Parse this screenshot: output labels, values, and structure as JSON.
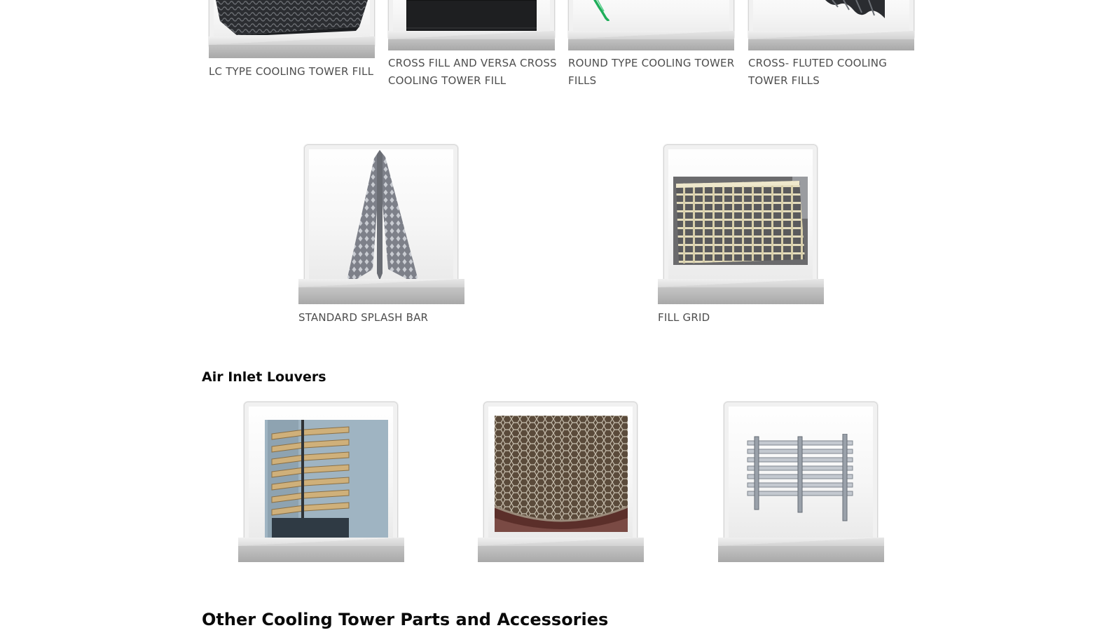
{
  "fills_row": {
    "items": [
      {
        "caption": "LC TYPE COOLING TOWER FILL",
        "image_icon": "lc-fill-image"
      },
      {
        "caption": "CROSS FILL AND VERSA CROSS COOLING TOWER FILL",
        "image_icon": "cross-fill-image"
      },
      {
        "caption": "ROUND TYPE COOLING TOWER FILLS",
        "image_icon": "round-fill-image"
      },
      {
        "caption": "CROSS- FLUTED COOLING TOWER FILLS",
        "image_icon": "cross-fluted-fill-image"
      }
    ]
  },
  "splash_row": {
    "items": [
      {
        "caption": "STANDARD SPLASH BAR",
        "image_icon": "splash-bar-image"
      },
      {
        "caption": "FILL GRID",
        "image_icon": "fill-grid-image"
      }
    ]
  },
  "louvers": {
    "heading": "Air Inlet Louvers",
    "items": [
      {
        "image_icon": "yellow-louver-image"
      },
      {
        "image_icon": "mesh-louver-image"
      },
      {
        "image_icon": "grey-louver-image"
      }
    ]
  },
  "accessories": {
    "heading": "Other Cooling Tower Parts and Accessories"
  },
  "colors": {
    "heading_text": "#0a0a0a",
    "caption_text": "#4e4e4e",
    "pedestal": "#bcbcbc",
    "frame_border": "#d6d6d6"
  }
}
